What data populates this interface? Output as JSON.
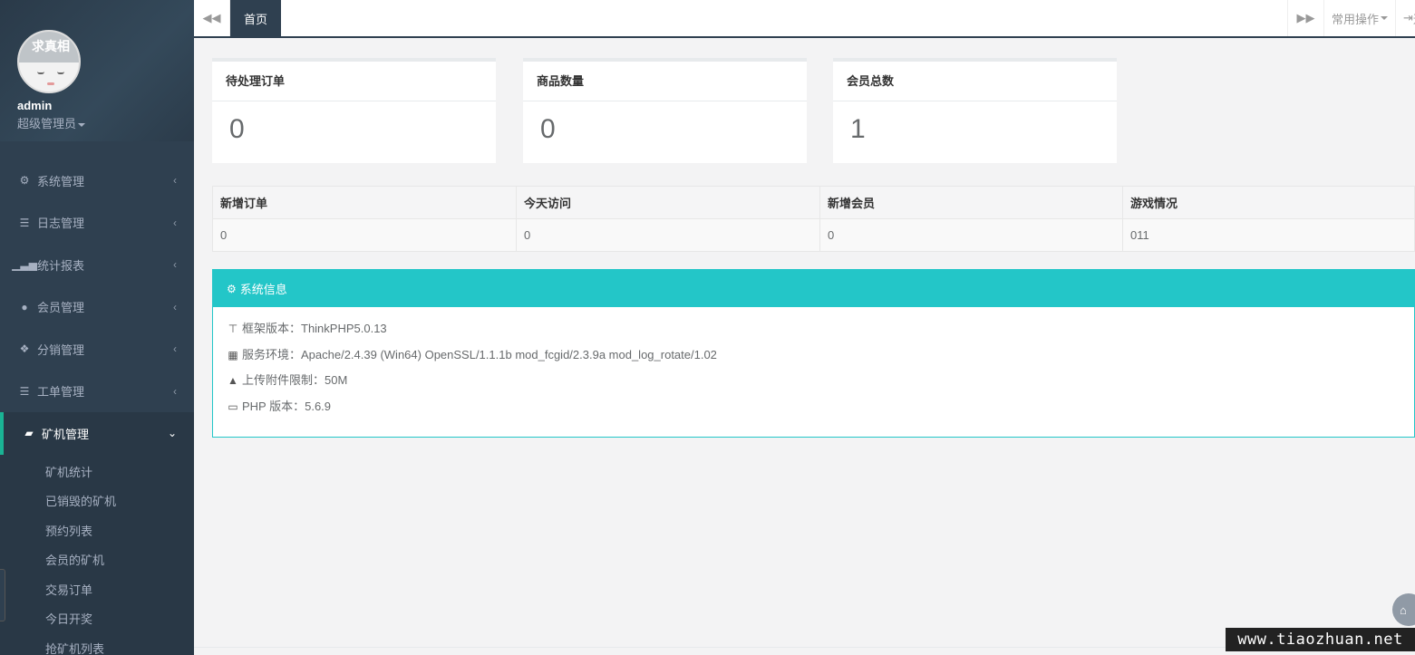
{
  "profile": {
    "avatar_text": "求真相",
    "name": "admin",
    "role": "超级管理员"
  },
  "nav": {
    "items": [
      {
        "label": "系统管理",
        "icon": "gear-icon"
      },
      {
        "label": "日志管理",
        "icon": "server-icon"
      },
      {
        "label": "统计报表",
        "icon": "signal-icon"
      },
      {
        "label": "会员管理",
        "icon": "user-icon"
      },
      {
        "label": "分销管理",
        "icon": "cubes-icon"
      },
      {
        "label": "工单管理",
        "icon": "server-icon"
      }
    ],
    "active": {
      "label": "矿机管理",
      "icon": "book-icon"
    },
    "submenu": [
      "矿机统计",
      "已销毁的矿机",
      "预约列表",
      "会员的矿机",
      "交易订单",
      "今日开奖",
      "抢矿机列表"
    ]
  },
  "topbar": {
    "home_tab": "首页",
    "ops_label": "常用操作",
    "logout_label": "退出"
  },
  "stats": [
    {
      "title": "待处理订单",
      "value": "0"
    },
    {
      "title": "商品数量",
      "value": "0"
    },
    {
      "title": "会员总数",
      "value": "1"
    }
  ],
  "table": {
    "headers": [
      "新增订单",
      "今天访问",
      "新增会员",
      "游戏情况"
    ],
    "row": [
      "0",
      "0",
      "0",
      "011"
    ]
  },
  "sysinfo": {
    "title": "系统信息",
    "rows": [
      {
        "icon": "sitemap-icon",
        "text": "框架版本：ThinkPHP5.0.13"
      },
      {
        "icon": "windows-icon",
        "text": "服务环境：Apache/2.4.39 (Win64) OpenSSL/1.1.1b mod_fcgid/2.3.9a mod_log_rotate/1.02"
      },
      {
        "icon": "warning-icon",
        "text": "上传附件限制：50M"
      },
      {
        "icon": "credit-card-icon",
        "text": "PHP 版本：5.6.9"
      }
    ]
  },
  "watermark": "www.tiaozhuan.net"
}
